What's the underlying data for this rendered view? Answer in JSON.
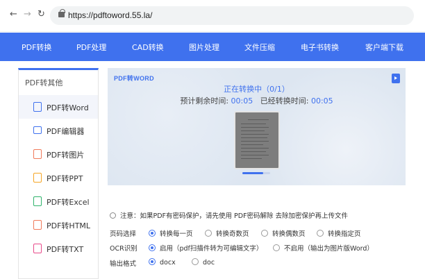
{
  "browser": {
    "url": "https://pdftoword.55.la/"
  },
  "topnav": [
    "PDF转换",
    "PDF处理",
    "CAD转换",
    "图片处理",
    "文件压缩",
    "电子书转换",
    "客户端下载"
  ],
  "sidebar": {
    "heading": "PDF转其他",
    "items": [
      {
        "label": "PDF转Word",
        "icon": "word-doc-icon",
        "color": "#3f71ee"
      },
      {
        "label": "PDF编辑器",
        "icon": "monitor-icon",
        "color": "#3f71ee"
      },
      {
        "label": "PDF转图片",
        "icon": "image-doc-icon",
        "color": "#f07a5a"
      },
      {
        "label": "PDF转PPT",
        "icon": "ppt-doc-icon",
        "color": "#f5a524"
      },
      {
        "label": "PDF转Excel",
        "icon": "excel-doc-icon",
        "color": "#2fb36b"
      },
      {
        "label": "PDF转HTML",
        "icon": "html-doc-icon",
        "color": "#f07a5a"
      },
      {
        "label": "PDF转TXT",
        "icon": "txt-doc-icon",
        "color": "#e84a8a"
      }
    ]
  },
  "panel": {
    "brand": "PDF转WORD",
    "status": "正在转换中（0/1）",
    "remaining_label": "预计剩余时间:",
    "remaining_value": "00:05",
    "elapsed_label": "已经转换时间:",
    "elapsed_value": "00:05",
    "progress": 0.75
  },
  "options": {
    "note": "注意：如果PDF有密码保护，请先使用 PDF密码解除 去除加密保护再上传文件",
    "pages_label": "页码选择",
    "pages": [
      {
        "label": "转换每一页",
        "selected": true
      },
      {
        "label": "转换奇数页",
        "selected": false
      },
      {
        "label": "转换偶数页",
        "selected": false
      },
      {
        "label": "转换指定页",
        "selected": false
      }
    ],
    "ocr_label": "OCR识别",
    "ocr": [
      {
        "label": "启用（pdf扫描件转为可编辑文字）",
        "selected": true
      },
      {
        "label": "不启用（输出为图片版Word）",
        "selected": false
      }
    ],
    "format_label": "输出格式",
    "formats": [
      {
        "label": "docx",
        "selected": true
      },
      {
        "label": "doc",
        "selected": false
      }
    ]
  }
}
